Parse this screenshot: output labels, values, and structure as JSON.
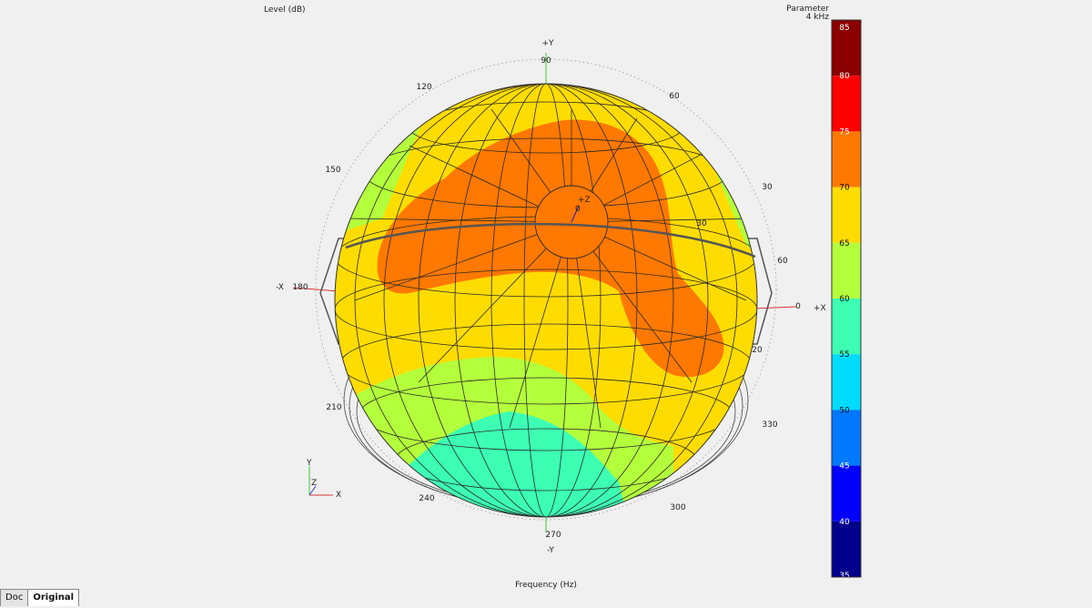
{
  "chart_data": {
    "type": "heatmap",
    "title": "Level (dB)",
    "xlabel": "Frequency (Hz)",
    "colorbar": {
      "title": "Parameter",
      "subtitle": "4 kHz",
      "ticks": [
        85,
        80,
        75,
        70,
        65,
        60,
        55,
        50,
        45,
        40,
        35
      ],
      "range": [
        35,
        85
      ],
      "band_colors": [
        "#8b0000",
        "#ff0000",
        "#ff7800",
        "#ffdc00",
        "#b4ff3c",
        "#3cffb4",
        "#00dcff",
        "#0078ff",
        "#0000ff",
        "#00008b"
      ]
    },
    "axes": {
      "plus_y": "+Y",
      "minus_y": "-Y",
      "plus_x": "+X",
      "minus_x": "-X",
      "plus_z": "+Z",
      "z_zero": "0"
    },
    "polar_angle_labels": [
      "90",
      "60",
      "30",
      "0",
      "330",
      "300",
      "270",
      "240",
      "210",
      "180",
      "150",
      "120"
    ],
    "elevation_labels": [
      "30",
      "60",
      "20"
    ],
    "level_regions": [
      {
        "level_db": 72.5,
        "color": "#ff7800",
        "location": "top cap and right lobe"
      },
      {
        "level_db": 67.5,
        "color": "#ffdc00",
        "location": "background"
      },
      {
        "level_db": 62.5,
        "color": "#b4ff3c",
        "location": "lower band and top-left/right rims"
      },
      {
        "level_db": 57.5,
        "color": "#3cffb4",
        "location": "bottom"
      }
    ],
    "triad": {
      "x": "X",
      "y": "Y",
      "z": "Z"
    }
  },
  "tabs": [
    {
      "label": "Doc",
      "active": false
    },
    {
      "label": "Original",
      "active": true
    }
  ]
}
